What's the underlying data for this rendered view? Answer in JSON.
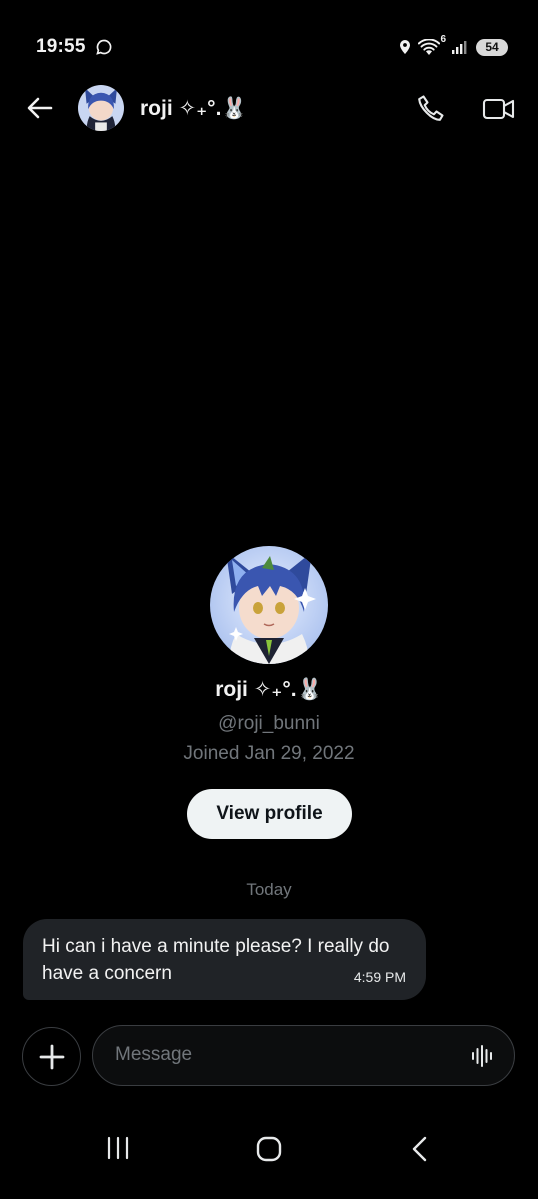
{
  "status_bar": {
    "time": "19:55",
    "battery": "54",
    "network": "6"
  },
  "header": {
    "contact_name": "roji ✧₊°.🐰"
  },
  "profile": {
    "name": "roji ✧₊°.🐰",
    "handle": "@roji_bunni",
    "joined": "Joined Jan 29, 2022",
    "view_profile_label": "View profile"
  },
  "conversation": {
    "day_separator": "Today",
    "messages": [
      {
        "text": "Hi can i have a minute please? I really do have a concern",
        "time": "4:59 PM"
      }
    ]
  },
  "composer": {
    "placeholder": "Message"
  },
  "icons": {
    "back": "arrow-left-icon",
    "call": "phone-icon",
    "video": "video-camera-icon",
    "add": "plus-icon",
    "voice": "voice-waveform-icon",
    "nav_recent": "recent-apps-icon",
    "nav_home": "home-icon",
    "nav_back": "chevron-left-icon"
  },
  "colors": {
    "background": "#000000",
    "bubble": "#202327",
    "muted_text": "#71767b",
    "button_bg": "#eff3f4"
  }
}
